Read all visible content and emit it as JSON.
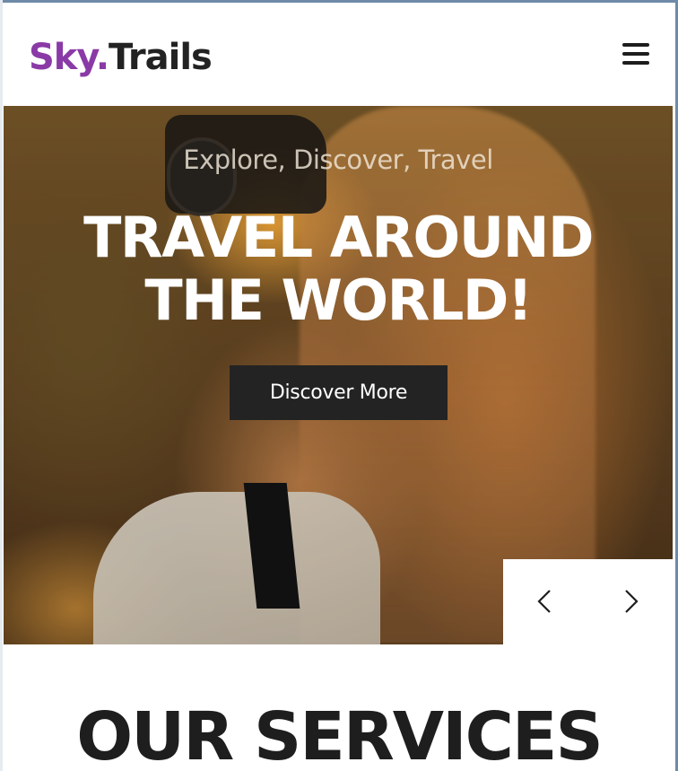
{
  "header": {
    "logo_part1": "Sky.",
    "logo_part2": "Trails",
    "menu_icon": "hamburger-menu-icon"
  },
  "hero": {
    "kicker": "Explore, Discover, Travel",
    "title_line1": "Travel Around",
    "title_line2": "The World!",
    "cta_label": "Discover More",
    "prev_icon": "chevron-left-icon",
    "next_icon": "chevron-right-icon"
  },
  "services": {
    "heading": "OUR SERVICES"
  },
  "colors": {
    "brand_purple": "#8a3aa6",
    "dark": "#232323",
    "white": "#ffffff"
  }
}
